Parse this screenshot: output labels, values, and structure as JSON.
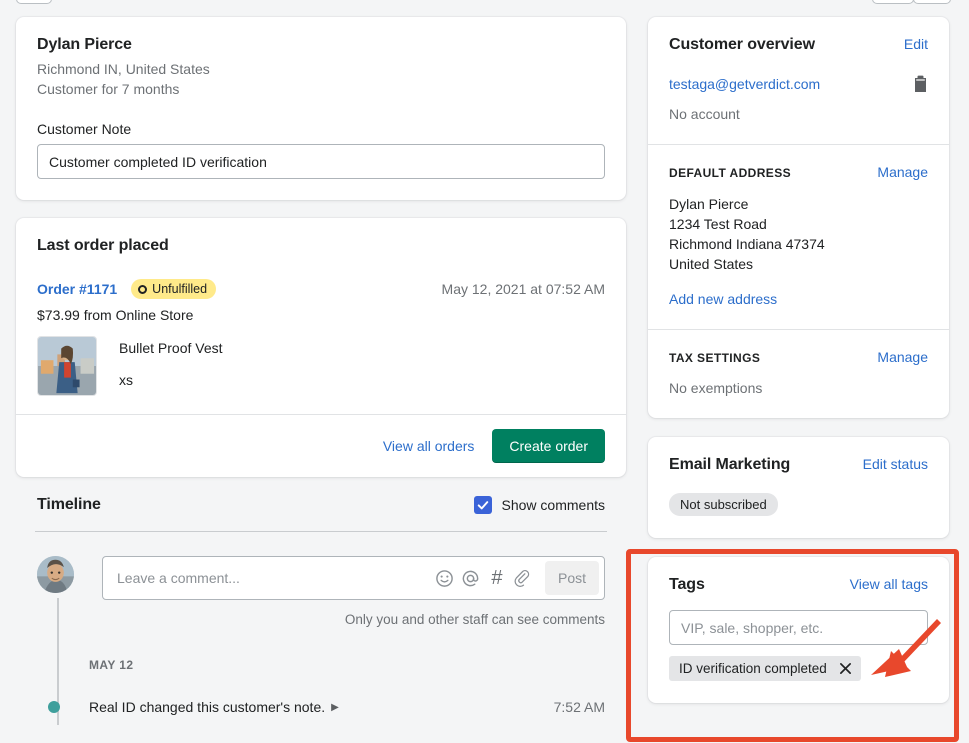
{
  "customer": {
    "name": "Dylan Pierce",
    "location": "Richmond IN, United States",
    "tenure": "Customer for 7 months",
    "note_label": "Customer Note",
    "note_value": "Customer completed ID verification"
  },
  "last_order": {
    "title": "Last order placed",
    "order_link": "Order #1171",
    "status_badge": "Unfulfilled",
    "status_icon": "unfulfilled-ring-icon",
    "date": "May 12, 2021 at 07:52 AM",
    "amount_source": "$73.99 from Online Store",
    "product_title": "Bullet Proof Vest",
    "product_variant": "xs",
    "view_all_label": "View all orders",
    "create_order_label": "Create order"
  },
  "timeline": {
    "title": "Timeline",
    "show_comments_label": "Show comments",
    "show_comments_checked": true,
    "comment_placeholder": "Leave a comment...",
    "post_label": "Post",
    "hint": "Only you and other staff can see comments",
    "icons": [
      "emoji-icon",
      "mention-icon",
      "hashtag-icon",
      "attachment-icon"
    ],
    "date_group": "MAY 12",
    "events": [
      {
        "text": "Real ID changed this customer's note.",
        "time": "7:52 AM"
      }
    ]
  },
  "overview": {
    "title": "Customer overview",
    "edit_label": "Edit",
    "email": "testaga@getverdict.com",
    "copy_icon": "clipboard-icon",
    "account_status": "No account",
    "address_heading": "DEFAULT ADDRESS",
    "address_manage_label": "Manage",
    "address_lines": [
      "Dylan Pierce",
      "1234 Test Road",
      "Richmond Indiana 47374",
      "United States"
    ],
    "add_address_label": "Add new address",
    "tax_heading": "TAX SETTINGS",
    "tax_manage_label": "Manage",
    "tax_status": "No exemptions"
  },
  "email_marketing": {
    "title": "Email Marketing",
    "edit_status_label": "Edit status",
    "status": "Not subscribed"
  },
  "tags": {
    "title": "Tags",
    "view_all_label": "View all tags",
    "input_placeholder": "VIP, sale, shopper, etc.",
    "chips": [
      {
        "label": "ID verification completed",
        "remove_icon": "close-icon"
      }
    ]
  },
  "annotation": {
    "highlight_color": "#e8482c",
    "arrow_color": "#e8482c",
    "target": "tags-card"
  }
}
